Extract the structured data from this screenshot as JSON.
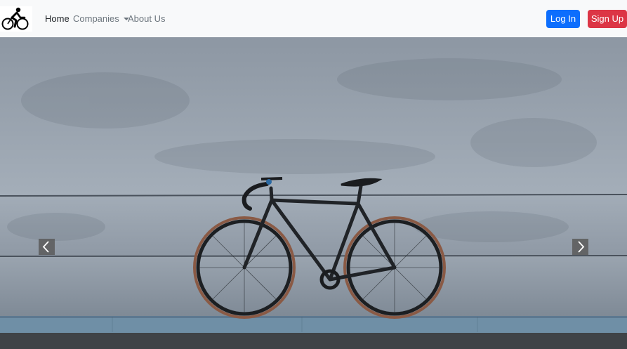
{
  "nav": {
    "logo_icon": "cyclist-logo-icon",
    "links": [
      {
        "label": "Home",
        "active": true
      },
      {
        "label": "Companies",
        "dropdown": true
      },
      {
        "label": "About Us"
      }
    ],
    "login_label": "Log In",
    "signup_label": "Sign Up"
  },
  "carousel": {
    "image_icon": "bicycle-against-concrete-wall-image",
    "prev_icon": "chevron-left-icon",
    "next_icon": "chevron-right-icon"
  },
  "colors": {
    "primary": "#0d6efd",
    "danger": "#dc3545",
    "navbar_bg": "#f8f9fa"
  }
}
